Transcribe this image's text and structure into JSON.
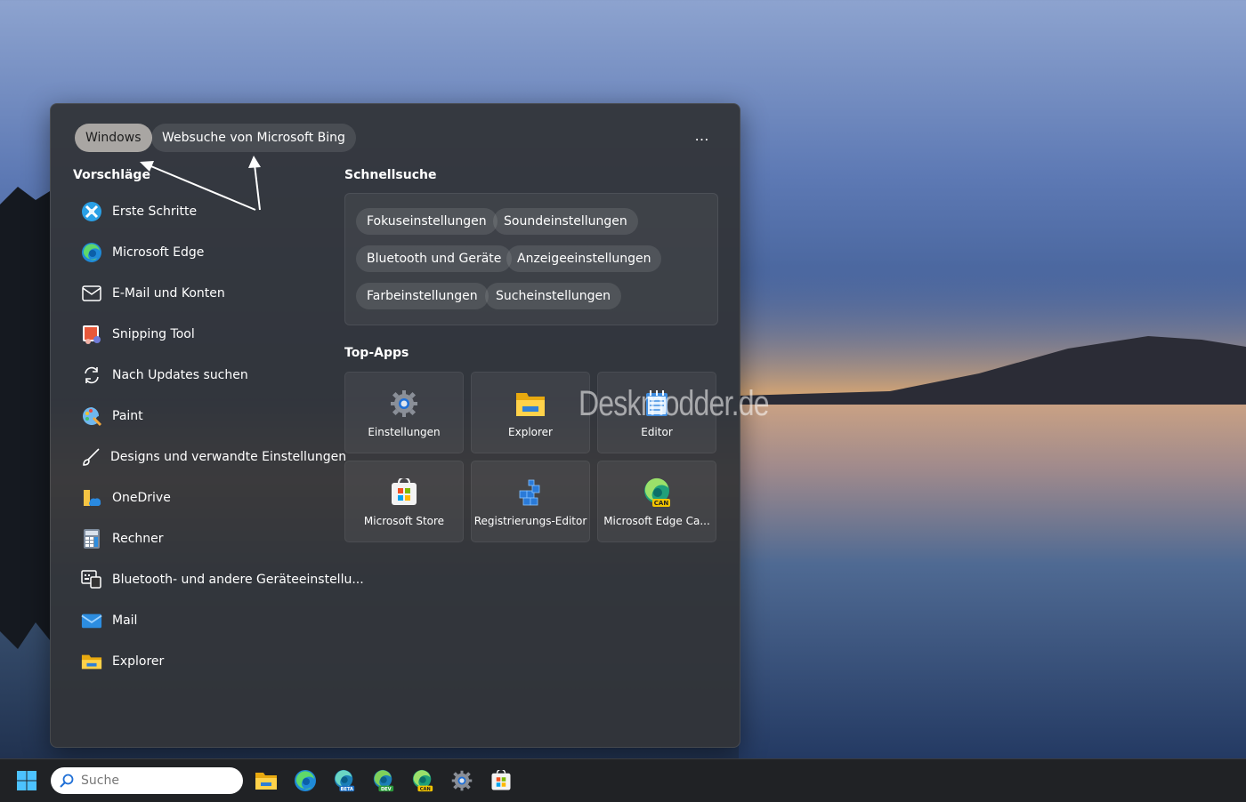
{
  "scopes": {
    "windows": "Windows",
    "bing": "Websuche von Microsoft Bing"
  },
  "more_label": "…",
  "suggestions_title": "Vorschläge",
  "suggestions": [
    {
      "label": "Erste Schritte",
      "icon": "get-started-icon"
    },
    {
      "label": "Microsoft Edge",
      "icon": "edge-icon"
    },
    {
      "label": "E-Mail und Konten",
      "icon": "mail-outline-icon"
    },
    {
      "label": "Snipping Tool",
      "icon": "snipping-tool-icon"
    },
    {
      "label": "Nach Updates suchen",
      "icon": "refresh-icon"
    },
    {
      "label": "Paint",
      "icon": "paint-icon"
    },
    {
      "label": "Designs und verwandte Einstellungen",
      "icon": "brush-icon"
    },
    {
      "label": "OneDrive",
      "icon": "onedrive-folder-icon"
    },
    {
      "label": "Rechner",
      "icon": "calculator-icon"
    },
    {
      "label": "Bluetooth- und andere Geräteeinstellu...",
      "icon": "devices-icon"
    },
    {
      "label": "Mail",
      "icon": "mail-app-icon"
    },
    {
      "label": "Explorer",
      "icon": "folder-icon"
    }
  ],
  "quick_title": "Schnellsuche",
  "quick": [
    "Fokuseinstellungen",
    "Soundeinstellungen",
    "Bluetooth und Geräte",
    "Anzeigeeinstellungen",
    "Farbeinstellungen",
    "Sucheinstellungen"
  ],
  "topapps_title": "Top-Apps",
  "topapps": [
    {
      "label": "Einstellungen",
      "icon": "settings-gear-icon"
    },
    {
      "label": "Explorer",
      "icon": "folder-icon"
    },
    {
      "label": "Editor",
      "icon": "notepad-icon"
    },
    {
      "label": "Microsoft Store",
      "icon": "store-icon"
    },
    {
      "label": "Registrierungs-Editor",
      "icon": "regedit-icon"
    },
    {
      "label": "Microsoft Edge Ca...",
      "icon": "edge-canary-icon"
    }
  ],
  "watermark": "Deskmodder.de",
  "taskbar": {
    "search_placeholder": "Suche",
    "icons": [
      "folder-icon",
      "edge-icon",
      "edge-beta-icon",
      "edge-dev-icon",
      "edge-canary-icon",
      "settings-gear-icon",
      "store-icon"
    ],
    "badges": {
      "beta": "BETA",
      "dev": "DEV",
      "can": "CAN"
    }
  },
  "colors": {
    "accent": "#0078d4",
    "panel": "#323438",
    "taskbar": "#202225"
  }
}
